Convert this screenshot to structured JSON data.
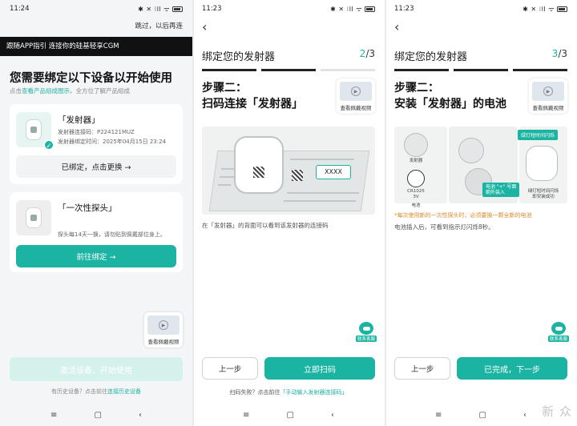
{
  "colors": {
    "accent": "#1bb3a1",
    "banner": "#111111",
    "warning": "#e08a2c"
  },
  "screen1": {
    "status": {
      "time": "11:24",
      "icons": "✱ ✕ ⁝ll ᯤ"
    },
    "skip": "跳过，以后再连",
    "banner": "跟随APP指引 连接你的硅基轻享CGM",
    "title": "您需要绑定以下设备以开始使用",
    "subtitle_pre": "点击",
    "subtitle_link": "查看产品组成图示",
    "subtitle_post": "，全方位了解产品组成",
    "device1": {
      "name": "「发射器」",
      "code": "发射器连接码：P224121MUZ",
      "time": "发射器绑定时间：2025年04月15日 23:24",
      "button": "已绑定，点击更换 →",
      "icon": "check-icon"
    },
    "device2": {
      "name": "「一次性探头」",
      "desc": "探头每14天一换，请勿贴到佩戴部位身上。",
      "button": "前往绑定 →"
    },
    "video_label": "查看佩戴视频",
    "activate": "激活设备，开始使用",
    "history_pre": "有历史设备？点击前往",
    "history_link": "连接历史设备"
  },
  "screen2": {
    "status": {
      "time": "11:23",
      "icons": "✱ ✕ ⁝ll ᯤ"
    },
    "title": "绑定您的发射器",
    "step_cur": "2",
    "step_total": "/3",
    "step_line1": "步骤二：",
    "step_line2": "扫码连接「发射器」",
    "video_label": "查看佩戴视频",
    "code_bubble": "XXXX",
    "caption": "在「发射器」的背面可以看到该发射器的连接码",
    "fab_label": "联系客服",
    "prev": "上一步",
    "next": "立即扫码",
    "fail_pre": "扫码失败？点击前往",
    "fail_link": "「手动输入发射器连接码」"
  },
  "screen3": {
    "status": {
      "time": "11:23",
      "icons": "✱ ✕ ⁝ll ᯤ"
    },
    "title": "绑定您的发射器",
    "step_cur": "3",
    "step_total": "/3",
    "step_line1": "步骤二：",
    "step_line2": "安装「发射器」的电池",
    "video_label": "查看佩戴视频",
    "green_tag1": "绿灯短时间闪烁",
    "green_tag2": "电池 \"+\" 号面\n朝外装入",
    "label_emitter": "发射器",
    "label_battery": "CR1025\n3V",
    "label_battery2": "电池",
    "label_flash": "绿灯短时间闪烁\n即安装成功",
    "warning": "*每次使用新的一次性探头时，必须要换一颗全新的电池",
    "caption": "电池插入后，可看到指示灯闪烁8秒。",
    "fab_label": "联系客服",
    "prev": "上一步",
    "next": "已完成，下一步",
    "watermark": "新 众"
  }
}
